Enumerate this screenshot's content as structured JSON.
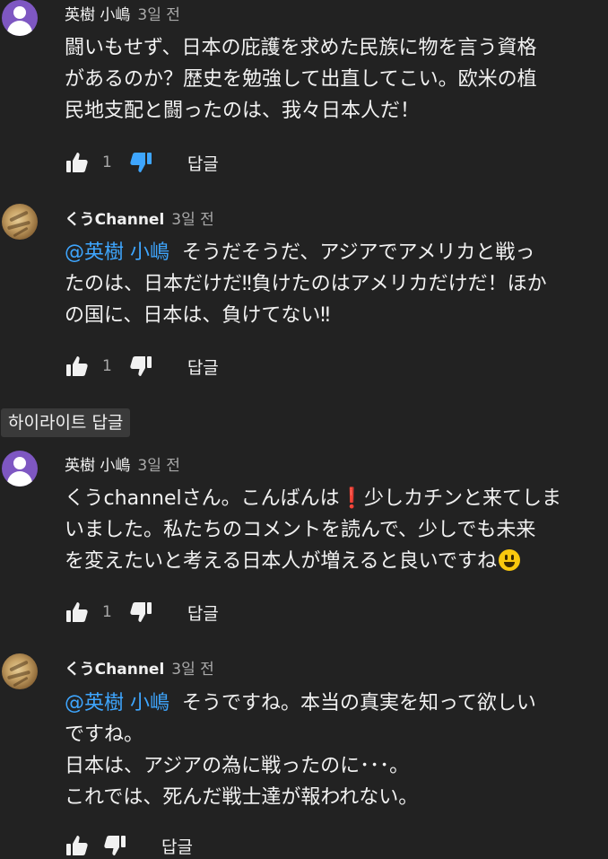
{
  "comments": [
    {
      "author": "英樹 小嶋",
      "time": "3일 전",
      "lines": [
        "闘いもせず、日本の庇護を求めた民族に物を言う資格",
        "があるのか？歴史を勉強して出直してこい。欧米の植",
        "民地支配と闘ったのは、我々日本人だ！"
      ],
      "likes": "1",
      "reply": "답글"
    },
    {
      "author": "くうChannel",
      "time": "3일 전",
      "mention": "@英樹 小嶋",
      "lines": [
        "そうだそうだ、アジアでアメリカと戦っ",
        "たのは、日本だけだ‼負けたのはアメリカだけだ！ほか",
        "の国に、日本は、負けてない‼"
      ],
      "likes": "1",
      "reply": "답글"
    },
    {
      "author": "英樹 小嶋",
      "time": "3일 전",
      "lines": [
        "くうchannelさん。こんばんは",
        "❗",
        "少しカチンと来てしま",
        "いました。私たちのコメントを読んで、少しでも未来",
        "を変えたいと考える日本人が増えると良いですね"
      ],
      "likes": "1",
      "reply": "답글"
    },
    {
      "author": "くうChannel",
      "time": "3일 전",
      "mention": "@英樹 小嶋",
      "lines": [
        "そうですね。本当の真実を知って欲しい",
        "ですね。",
        "日本は、アジアの為に戦ったのに･･･。",
        "これでは、死んだ戦士達が報われない。"
      ],
      "likes": "",
      "reply": "답글"
    }
  ],
  "highlight_label": "하이라이트 답글",
  "colors": {
    "background": "#222222",
    "text": "#f1f1f1",
    "secondary": "#aaaaaa",
    "mention": "#3ea6ff",
    "disliked": "#3ea6ff"
  },
  "icons": {
    "like": "thumbs-up-icon",
    "dislike": "thumbs-down-icon",
    "emoji": "grinning-face-emoji-icon",
    "exclamation": "red-exclamation-icon"
  }
}
